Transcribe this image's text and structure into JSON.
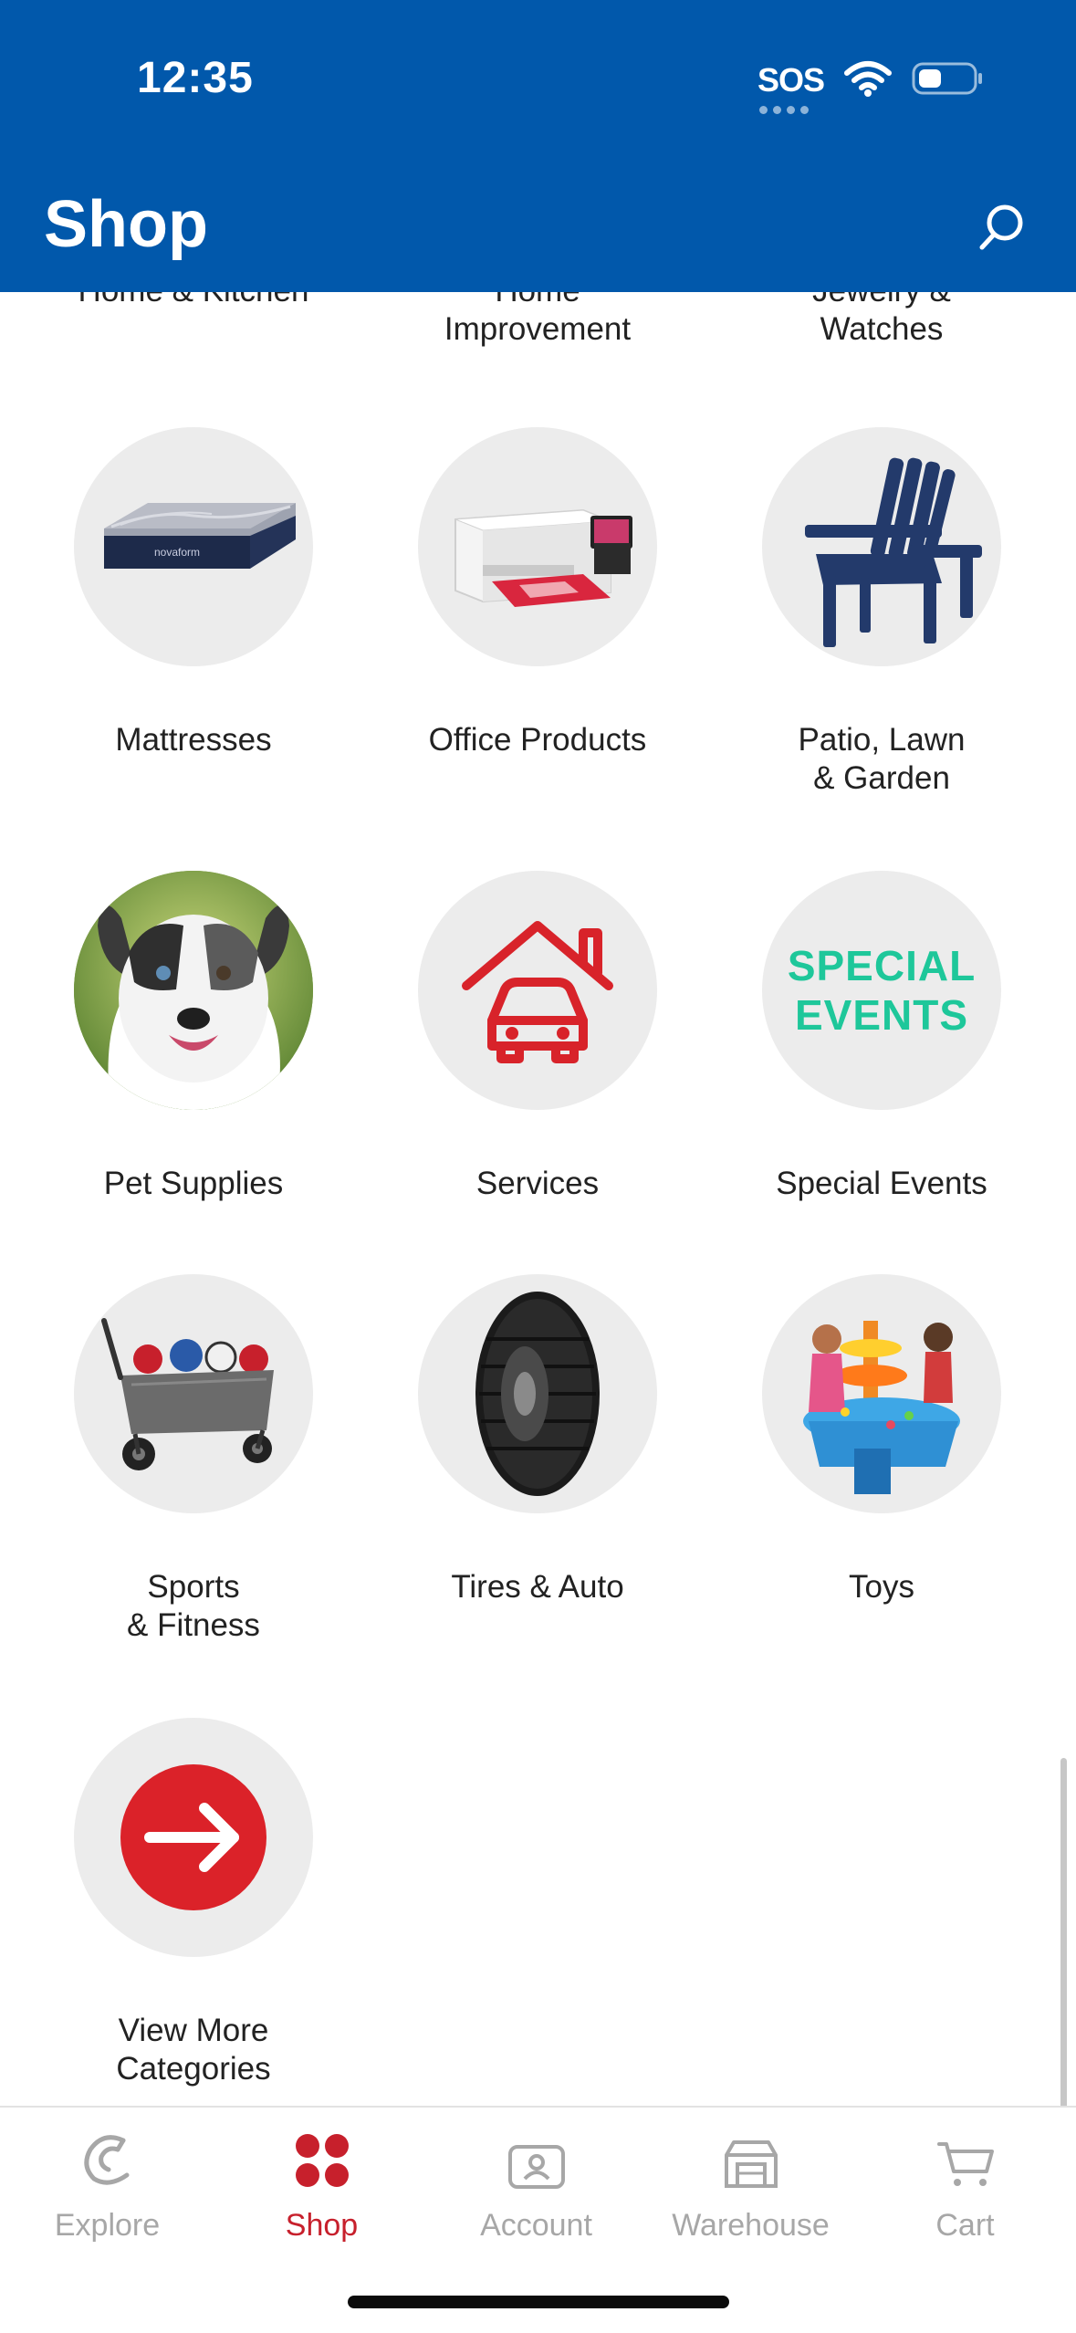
{
  "status_bar": {
    "time": "12:35",
    "sos": "SOS"
  },
  "header": {
    "title": "Shop"
  },
  "partial_row": [
    {
      "label": "Home & Kitchen"
    },
    {
      "label": "Home\nImprovement"
    },
    {
      "label": "Jewelry &\nWatches"
    }
  ],
  "categories": [
    {
      "label": "Mattresses",
      "icon": "mattress-image"
    },
    {
      "label": "Office Products",
      "icon": "printer-image"
    },
    {
      "label": "Patio, Lawn\n& Garden",
      "icon": "adirondack-chair-image"
    },
    {
      "label": "Pet Supplies",
      "icon": "dog-photo"
    },
    {
      "label": "Services",
      "icon": "house-car-icon"
    },
    {
      "label": "Special Events",
      "icon": "special-events-badge",
      "badge_lines": [
        "SPECIAL",
        "EVENTS"
      ]
    },
    {
      "label": "Sports\n& Fitness",
      "icon": "wagon-image"
    },
    {
      "label": "Tires & Auto",
      "icon": "tire-image"
    },
    {
      "label": "Toys",
      "icon": "water-table-image"
    },
    {
      "label": "View More\nCategories",
      "icon": "arrow-right-icon"
    }
  ],
  "tabbar": {
    "items": [
      {
        "label": "Explore",
        "icon": "explore-icon",
        "active": false
      },
      {
        "label": "Shop",
        "icon": "shop-icon",
        "active": true
      },
      {
        "label": "Account",
        "icon": "account-icon",
        "active": false
      },
      {
        "label": "Warehouse",
        "icon": "warehouse-icon",
        "active": false
      },
      {
        "label": "Cart",
        "icon": "cart-icon",
        "active": false
      }
    ]
  },
  "colors": {
    "header_bg": "#0158ab",
    "active_tab": "#c7202c",
    "inactive_tab": "#a7a7a7",
    "special_events_text": "#1ec79a",
    "services_icon": "#d8232a",
    "circle_bg": "#ececec"
  }
}
